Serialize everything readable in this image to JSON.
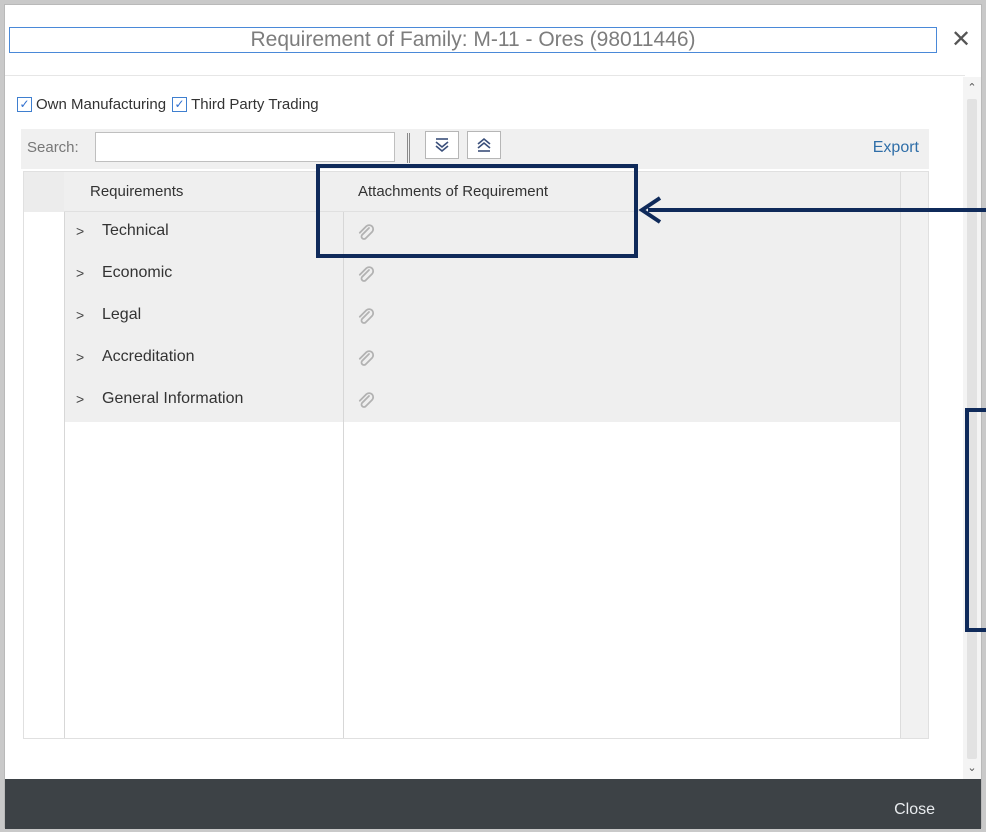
{
  "dialog": {
    "title": "Requirement of Family: M-11 - Ores (98011446)",
    "close_glyph": "✕"
  },
  "filters": [
    {
      "label": "Own Manufacturing",
      "checked": true
    },
    {
      "label": "Third Party Trading",
      "checked": true
    }
  ],
  "toolbar": {
    "search_label": "Search:",
    "search_value": "",
    "expand_icon": "expand-all-icon",
    "collapse_icon": "collapse-all-icon",
    "export_label": "Export"
  },
  "table": {
    "columns": [
      "Requirements",
      "Attachments of Requirement"
    ],
    "rows": [
      {
        "label": "Technical",
        "attachment_icon": "paperclip-icon"
      },
      {
        "label": "Economic",
        "attachment_icon": "paperclip-icon"
      },
      {
        "label": "Legal",
        "attachment_icon": "paperclip-icon"
      },
      {
        "label": "Accreditation",
        "attachment_icon": "paperclip-icon"
      },
      {
        "label": "General Information",
        "attachment_icon": "paperclip-icon"
      }
    ]
  },
  "footer": {
    "close_label": "Close"
  },
  "colors": {
    "accent": "#2f6ea8",
    "annotation": "#0f2a5a",
    "footer": "#3d4246"
  }
}
